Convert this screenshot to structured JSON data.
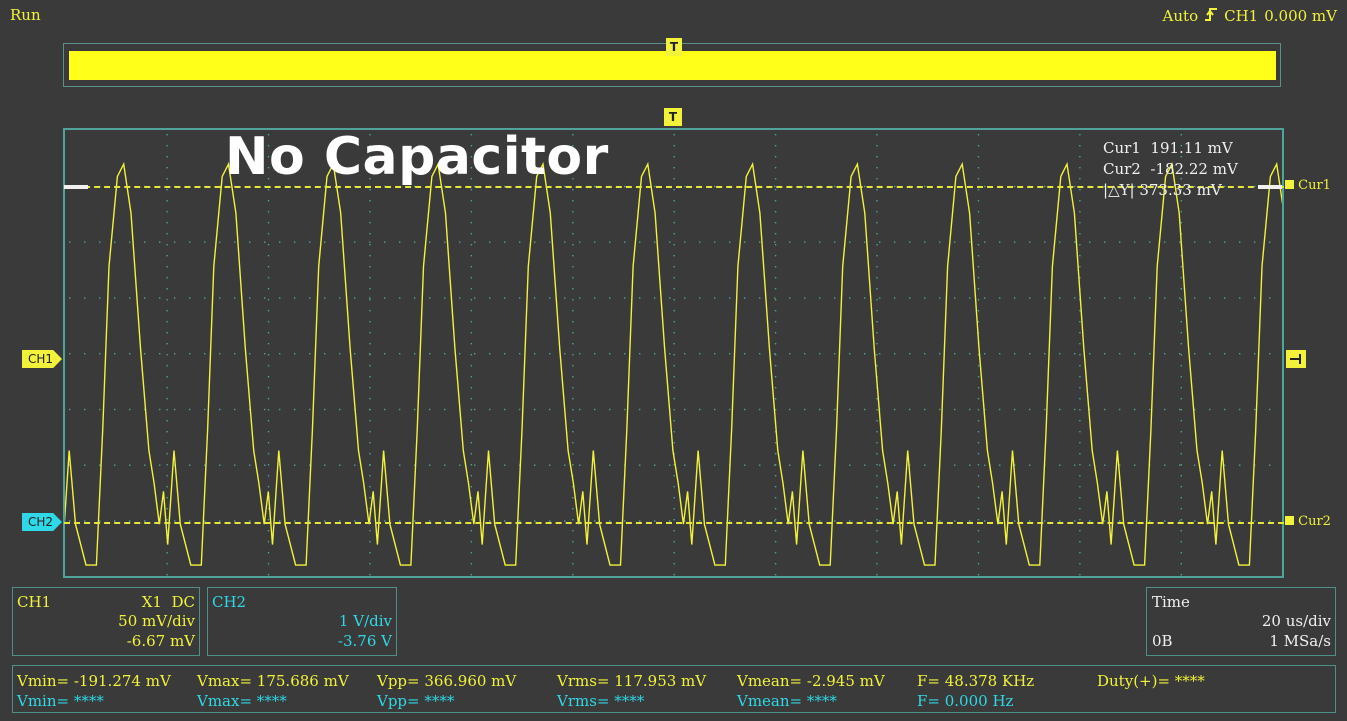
{
  "status": {
    "run": "Run",
    "trigger_mode": "Auto",
    "trigger_source": "CH1",
    "trigger_level": "0.000 mV"
  },
  "title": "No Capacitor",
  "cursors": {
    "cur1_label": "Cur1",
    "cur1_value": "191.11 mV",
    "cur2_label": "Cur2",
    "cur2_value": "-182.22 mV",
    "delta_label": "△Y",
    "delta_value": "373.33 mV",
    "marker1": "Cur1",
    "marker2": "Cur2"
  },
  "markers": {
    "ch1": "CH1",
    "ch2": "CH2",
    "trigger": "T"
  },
  "ch1_panel": {
    "name": "CH1",
    "probe": "X1",
    "coupling": "DC",
    "scale": "50 mV/div",
    "offset": "-6.67 mV"
  },
  "ch2_panel": {
    "name": "CH2",
    "scale": "1 V/div",
    "offset": "-3.76 V"
  },
  "time_panel": {
    "label": "Time",
    "scale": "20 us/div",
    "memory": "0B",
    "rate": "1 MSa/s"
  },
  "measurements": {
    "ch1": {
      "vmin": "Vmin= -191.274 mV",
      "vmax": "Vmax= 175.686 mV",
      "vpp": "Vpp= 366.960 mV",
      "vrms": "Vrms= 117.953 mV",
      "vmean": "Vmean= -2.945 mV",
      "freq": "F= 48.378 KHz",
      "duty": "Duty(+)= ****"
    },
    "ch2": {
      "vmin": "Vmin= ****",
      "vmax": "Vmax= ****",
      "vpp": "Vpp= ****",
      "vrms": "Vrms= ****",
      "vmean": "Vmean= ****",
      "freq": "F= 0.000 Hz"
    }
  },
  "colors": {
    "ch1": "#f2f23a",
    "ch2": "#2fd8e6",
    "grid": "#4fa39b",
    "background": "#3a3a3a"
  },
  "chart_data": {
    "type": "line",
    "series": [
      {
        "name": "CH1",
        "frequency_khz": 48.378,
        "vmax_mv": 175.686,
        "vmin_mv": -191.274
      }
    ],
    "grid": true
  }
}
